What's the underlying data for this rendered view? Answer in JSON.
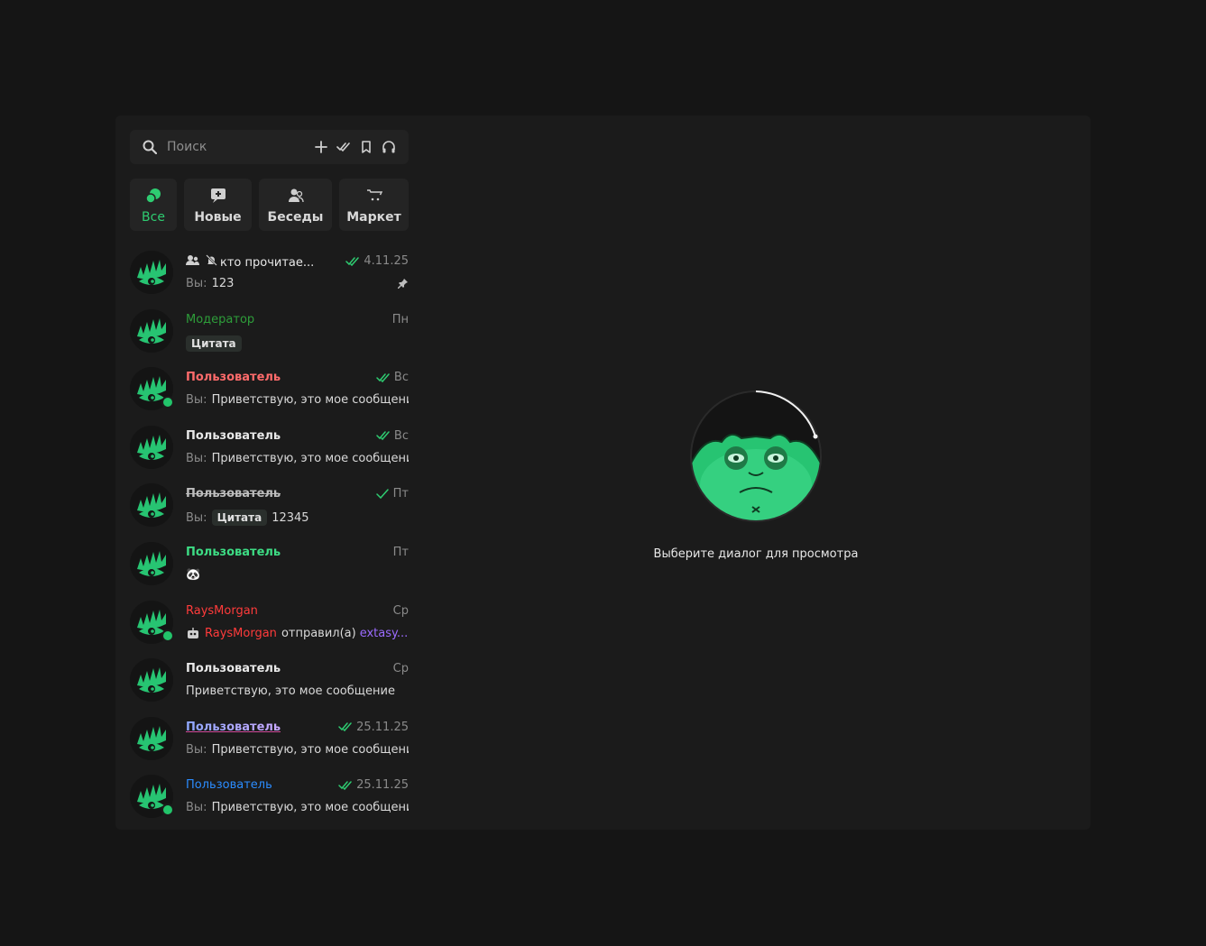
{
  "search": {
    "placeholder": "Поиск"
  },
  "tabs": [
    {
      "label": "Все",
      "active": true
    },
    {
      "label": "Новые"
    },
    {
      "label": "Беседы"
    },
    {
      "label": "Маркет"
    }
  ],
  "chats": [
    {
      "name": "кто прочитае...",
      "date": "4.11.25",
      "you": "Вы:",
      "preview": "123",
      "read": true,
      "pinned": true,
      "group": true,
      "muted": true
    },
    {
      "name": "Модератор",
      "date": "Пн",
      "quote": "Цитата"
    },
    {
      "name": "Пользователь",
      "date": "Вс",
      "you": "Вы:",
      "preview": "Приветствую, это мое сообщени...",
      "read": true,
      "online": true
    },
    {
      "name": "Пользователь",
      "date": "Вс",
      "you": "Вы:",
      "preview": "Приветствую, это мое сообщени...",
      "read": true
    },
    {
      "name": "Пользователь",
      "date": "Пт",
      "you": "Вы:",
      "quote": "Цитата",
      "preview": "12345",
      "sent": true
    },
    {
      "name": "Пользователь",
      "date": "Пт",
      "preview_emoji": "🐼"
    },
    {
      "name": "RaysMorgan",
      "date": "Ср",
      "bot_user": "RaysMorgan",
      "bot_action": "отправил(а)",
      "bot_target": "extasy...",
      "online": true
    },
    {
      "name": "Пользователь",
      "date": "Ср",
      "preview": "Приветствую, это мое сообщение"
    },
    {
      "name": "Пользователь",
      "date": "25.11.25",
      "you": "Вы:",
      "preview": "Приветствую, это мое сообщени...",
      "read": true
    },
    {
      "name": "Пользователь",
      "date": "25.11.25",
      "you": "Вы:",
      "preview": "Приветствую, это мое сообщени...",
      "read": true,
      "online": true
    }
  ],
  "main": {
    "empty_text": "Выберите диалог для просмотра"
  },
  "colors": {
    "accent": "#2ecc71",
    "moderator": "#2e9e3a",
    "red": "#ff6b6b",
    "white": "#e8e8e8",
    "strike": "#bdbdbd",
    "green": "#3ddc84",
    "raysmorgan": "#ff3b3b",
    "gradient": "#a7a6ff",
    "blue": "#2b8cff",
    "purple": "#9b6bff"
  }
}
